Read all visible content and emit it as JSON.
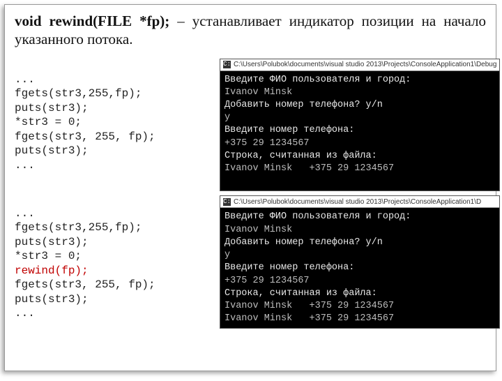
{
  "heading": {
    "signature": "void rewind(FILE *fp);",
    "desc": " – устанавливает индикатор позиции на начало указанного потока."
  },
  "code1": {
    "l0": "...",
    "l1": "fgets(str3,255,fp);",
    "l2": "puts(str3);",
    "l3": "*str3 = 0;",
    "l4": "fgets(str3, 255, fp);",
    "l5": "puts(str3);",
    "l6": "..."
  },
  "code2": {
    "l0": "...",
    "l1": "fgets(str3,255,fp);",
    "l2": "puts(str3);",
    "l3": "*str3 = 0;",
    "l4": "rewind(fp);",
    "l5": "fgets(str3, 255, fp);",
    "l6": "puts(str3);",
    "l7": "..."
  },
  "term1": {
    "title": "C:\\Users\\Polubok\\documents\\visual studio 2013\\Projects\\ConsoleApplication1\\Debug",
    "l0": "Введите ФИО пользователя и город:",
    "l1": "Ivanov Minsk",
    "l2": "Добавить номер телефона? y/n",
    "l3": "y",
    "l4": "Введите номер телефона:",
    "l5": "+375 29 1234567",
    "l6": "Строка, считанная из файла:",
    "l7": "Ivanov Minsk   +375 29 1234567",
    "l8": " "
  },
  "term2": {
    "title": "C:\\Users\\Polubok\\documents\\visual studio 2013\\Projects\\ConsoleApplication1\\D",
    "l0": "Введите ФИО пользователя и город:",
    "l1": "Ivanov Minsk",
    "l2": "Добавить номер телефона? y/n",
    "l3": "y",
    "l4": "Введите номер телефона:",
    "l5": "+375 29 1234567",
    "l6": "Строка, считанная из файла:",
    "l7": "Ivanov Minsk   +375 29 1234567",
    "l8": "Ivanov Minsk   +375 29 1234567"
  }
}
